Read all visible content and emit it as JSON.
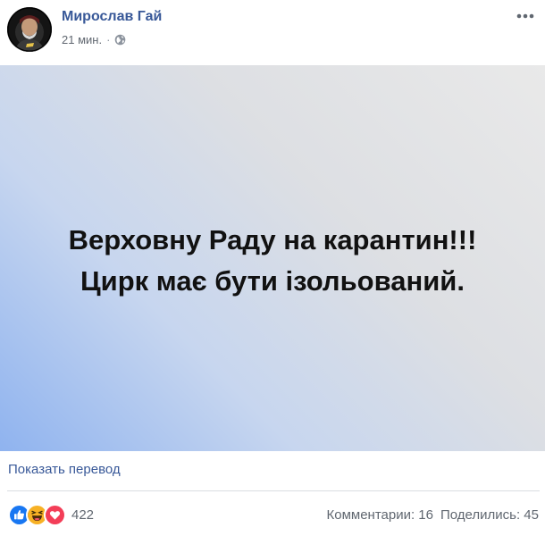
{
  "post": {
    "author": "Мирослав Гай",
    "time": "21 мин.",
    "meta_separator": "·",
    "privacy_icon": "globe-icon",
    "more_icon": "more-dots-icon",
    "media_text": "Верховну Раду на карантин!!! Цирк має бути ізольований.",
    "translate_link": "Показать перевод"
  },
  "reactions": {
    "icons": [
      "like-icon",
      "haha-icon",
      "love-icon"
    ],
    "count": "422",
    "comments": "Комментарии: 16",
    "shares": "Поделились: 45"
  },
  "colors": {
    "link": "#385898",
    "secondary_text": "#606770",
    "like": "#1877f2",
    "haha": "#f7b125",
    "love": "#f33e58",
    "gradient_light": "#e9e9e9",
    "gradient_blue": "#8fb3ef"
  }
}
